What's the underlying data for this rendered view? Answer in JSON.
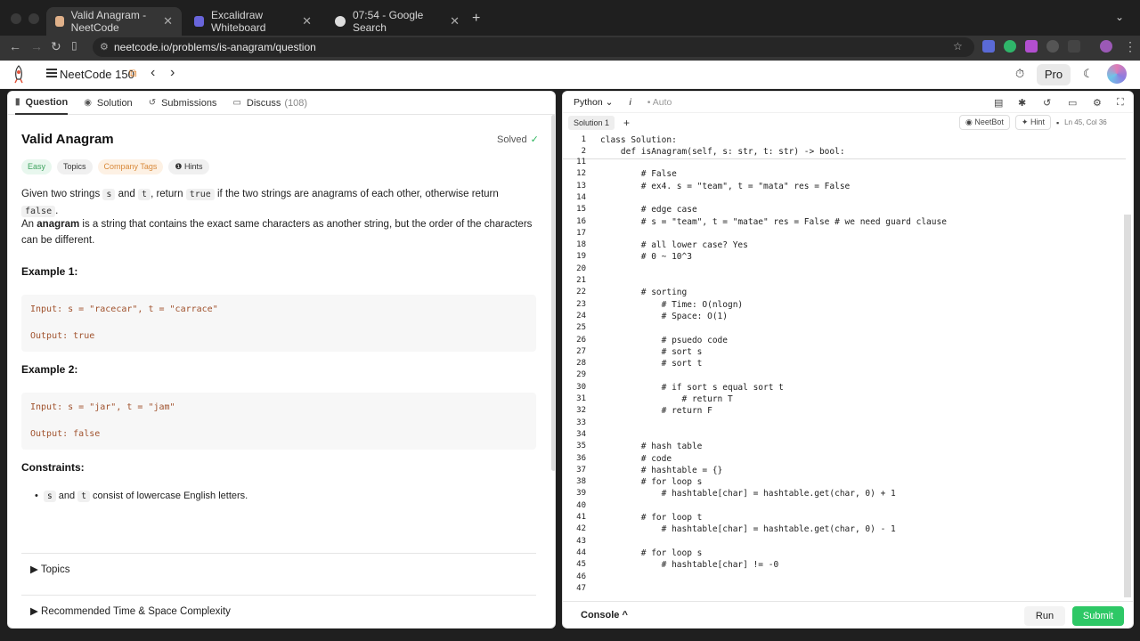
{
  "browser": {
    "tabs": [
      {
        "title": "Valid Anagram - NeetCode",
        "active": true
      },
      {
        "title": "Excalidraw Whiteboard",
        "active": false
      },
      {
        "title": "07:54 - Google Search",
        "active": false
      }
    ],
    "url": "neetcode.io/problems/is-anagram/question"
  },
  "header": {
    "title": "NeetCode 150",
    "pro_label": "Pro"
  },
  "left": {
    "tabs": [
      {
        "label": "Question"
      },
      {
        "label": "Solution"
      },
      {
        "label": "Submissions"
      },
      {
        "label": "Discuss",
        "count": "(108)"
      }
    ],
    "title": "Valid Anagram",
    "status": "Solved",
    "badges": [
      "Easy",
      "Topics",
      "Company Tags",
      "Hints"
    ],
    "desc1_a": "Given two strings",
    "desc1_s": "s",
    "desc1_and": "and",
    "desc1_t": "t",
    "desc1_b": ", return",
    "desc1_true": "true",
    "desc1_c": "if the two strings are anagrams of each other, otherwise return",
    "desc1_false": "false",
    "desc1_end": ".",
    "desc2_a": "An",
    "desc2_bold": "anagram",
    "desc2_b": "is a string that contains the exact same characters as another string, but the order of the characters can be different.",
    "example1_title": "Example 1:",
    "example1_input": "Input: s = \"racecar\", t = \"carrace\"",
    "example1_output": "Output: true",
    "example2_title": "Example 2:",
    "example2_input": "Input: s = \"jar\", t = \"jam\"",
    "example2_output": "Output: false",
    "constraints_title": "Constraints:",
    "constraint_s": "s",
    "constraint_and": "and",
    "constraint_t": "t",
    "constraint_text": "consist of lowercase English letters.",
    "accordion": [
      "Topics",
      "Recommended Time & Space Complexity"
    ]
  },
  "editor": {
    "language": "Python",
    "info": "i",
    "mode": "Auto",
    "solution_tab": "Solution 1",
    "neetbot": "NeetBot",
    "hint": "Hint",
    "cursor": "Ln 45, Col 36",
    "sticky_lines": [
      {
        "n": "1",
        "t": "class Solution:"
      },
      {
        "n": "2",
        "t": "    def isAnagram(self, s: str, t: str) -> bool:"
      }
    ],
    "lines": [
      {
        "n": "11",
        "t": ""
      },
      {
        "n": "12",
        "t": "        # False"
      },
      {
        "n": "13",
        "t": "        # ex4. s = \"team\", t = \"mata\" res = False"
      },
      {
        "n": "14",
        "t": ""
      },
      {
        "n": "15",
        "t": "        # edge case"
      },
      {
        "n": "16",
        "t": "        # s = \"team\", t = \"matae\" res = False # we need guard clause"
      },
      {
        "n": "17",
        "t": ""
      },
      {
        "n": "18",
        "t": "        # all lower case? Yes"
      },
      {
        "n": "19",
        "t": "        # 0 ~ 10^3"
      },
      {
        "n": "20",
        "t": ""
      },
      {
        "n": "21",
        "t": ""
      },
      {
        "n": "22",
        "t": "        # sorting"
      },
      {
        "n": "23",
        "t": "            # Time: O(nlogn)"
      },
      {
        "n": "24",
        "t": "            # Space: O(1)"
      },
      {
        "n": "25",
        "t": ""
      },
      {
        "n": "26",
        "t": "            # psuedo code"
      },
      {
        "n": "27",
        "t": "            # sort s"
      },
      {
        "n": "28",
        "t": "            # sort t"
      },
      {
        "n": "29",
        "t": ""
      },
      {
        "n": "30",
        "t": "            # if sort s equal sort t"
      },
      {
        "n": "31",
        "t": "                # return T"
      },
      {
        "n": "32",
        "t": "            # return F"
      },
      {
        "n": "33",
        "t": ""
      },
      {
        "n": "34",
        "t": ""
      },
      {
        "n": "35",
        "t": "        # hash table"
      },
      {
        "n": "36",
        "t": "        # code"
      },
      {
        "n": "37",
        "t": "        # hashtable = {}"
      },
      {
        "n": "38",
        "t": "        # for loop s"
      },
      {
        "n": "39",
        "t": "            # hashtable[char] = hashtable.get(char, 0) + 1"
      },
      {
        "n": "40",
        "t": ""
      },
      {
        "n": "41",
        "t": "        # for loop t"
      },
      {
        "n": "42",
        "t": "            # hashtable[char] = hashtable.get(char, 0) - 1"
      },
      {
        "n": "43",
        "t": ""
      },
      {
        "n": "44",
        "t": "        # for loop s"
      },
      {
        "n": "45",
        "t": "            # hashtable[char] != -0"
      },
      {
        "n": "46",
        "t": ""
      },
      {
        "n": "47",
        "t": ""
      }
    ],
    "console_label": "Console",
    "run_label": "Run",
    "submit_label": "Submit"
  },
  "colors": {
    "accent_green": "#2ec866",
    "comment_blue": "#2f5fb5",
    "company_orange": "#d8893a"
  }
}
